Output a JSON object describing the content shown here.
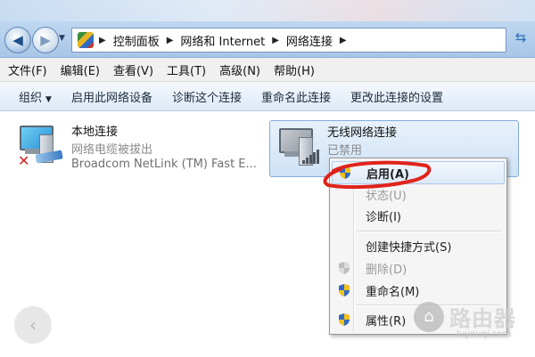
{
  "address": {
    "crumbs": [
      "控制面板",
      "网络和 Internet",
      "网络连接"
    ]
  },
  "menu": [
    "文件(F)",
    "编辑(E)",
    "查看(V)",
    "工具(T)",
    "高级(N)",
    "帮助(H)"
  ],
  "commands": {
    "organize": "组织",
    "enable_device": "启用此网络设备",
    "diagnose": "诊断这个连接",
    "rename": "重命名此连接",
    "change_settings": "更改此连接的设置"
  },
  "connections": {
    "lan": {
      "name": "本地连接",
      "status": "网络电缆被拔出",
      "device": "Broadcom NetLink (TM) Fast E..."
    },
    "wifi": {
      "name": "无线网络连接",
      "status": "已禁用"
    }
  },
  "context_menu": {
    "enable": "启用(A)",
    "status": "状态(U)",
    "diagnose": "诊断(I)",
    "create_shortcut": "创建快捷方式(S)",
    "delete": "删除(D)",
    "rename": "重命名(M)",
    "properties": "属性(R)"
  },
  "watermark": {
    "name": "路由器",
    "url": "luyouqi.com"
  },
  "colors": {
    "accent": "#3a7bc4",
    "highlight_mark": "#e0231b"
  }
}
